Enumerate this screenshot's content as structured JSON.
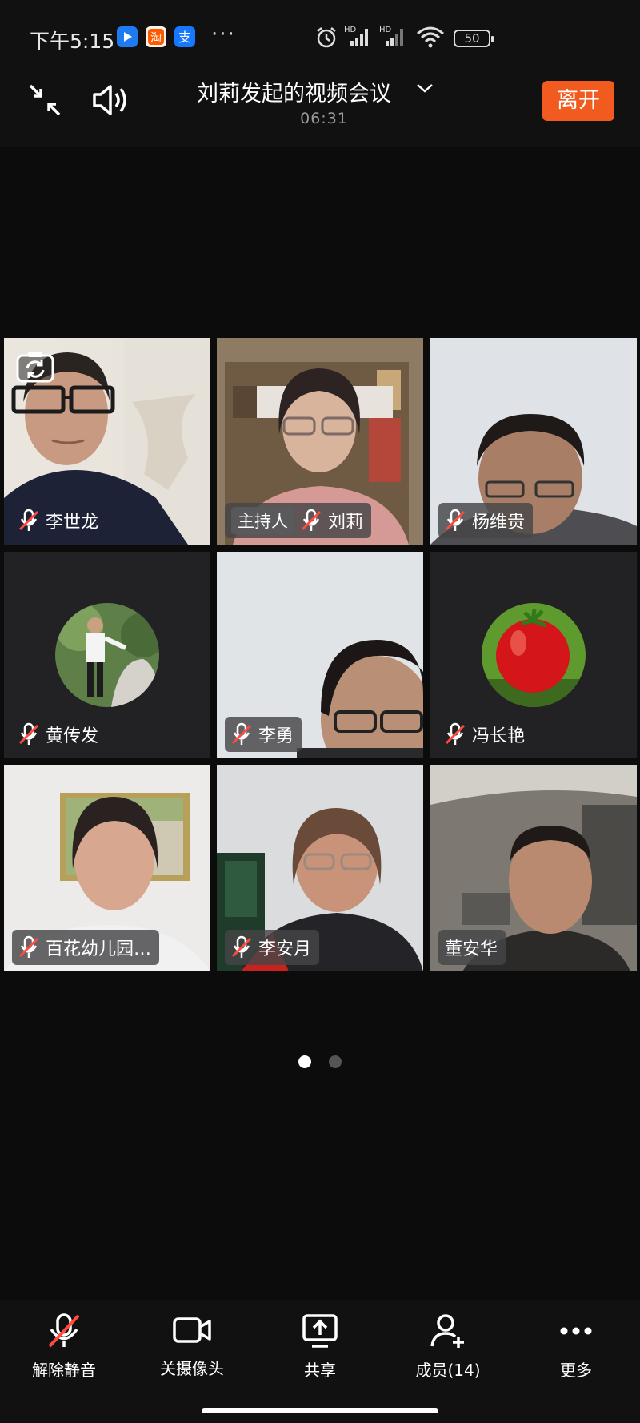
{
  "status_bar": {
    "time": "下午5:15",
    "app_badges": [
      "map-app-icon",
      "taobao-app-icon",
      "alipay-app-icon"
    ],
    "more": "···",
    "battery": "50"
  },
  "header": {
    "title": "刘莉发起的视频会议",
    "timer": "06:31",
    "leave_label": "离开"
  },
  "participants": [
    {
      "name": "李世龙",
      "muted": true,
      "host": false
    },
    {
      "name": "刘莉",
      "muted": true,
      "host": true,
      "host_label": "主持人"
    },
    {
      "name": "杨维贵",
      "muted": true,
      "host": false
    },
    {
      "name": "黄传发",
      "muted": true,
      "host": false,
      "avatar": true
    },
    {
      "name": "李勇",
      "muted": true,
      "host": false
    },
    {
      "name": "冯长艳",
      "muted": true,
      "host": false,
      "avatar": true
    },
    {
      "name": "百花幼儿园…",
      "muted": true,
      "host": false
    },
    {
      "name": "李安月",
      "muted": true,
      "host": false
    },
    {
      "name": "董安华",
      "muted": false,
      "host": false
    }
  ],
  "pagination": {
    "pages": 2,
    "current": 1
  },
  "toolbar": {
    "unmute_label": "解除静音",
    "camera_label": "关摄像头",
    "share_label": "共享",
    "members_label": "成员(14)",
    "more_label": "更多"
  },
  "colors": {
    "accent": "#f25b1f",
    "mic_off": "#ff4a3d"
  }
}
